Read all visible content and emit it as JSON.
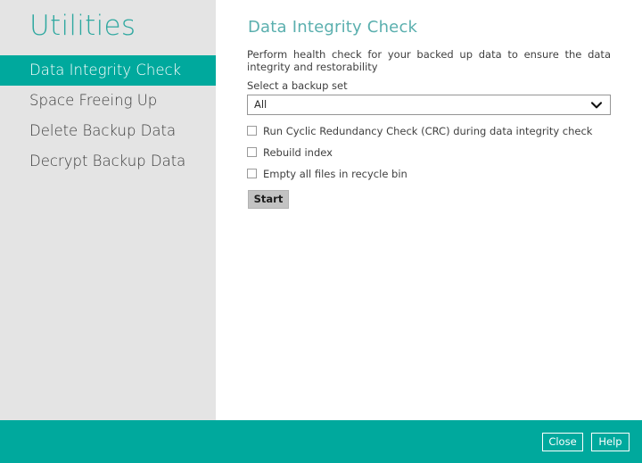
{
  "sidebar": {
    "title": "Utilities",
    "items": [
      {
        "label": "Data Integrity Check",
        "active": true
      },
      {
        "label": "Space Freeing Up",
        "active": false
      },
      {
        "label": "Delete Backup Data",
        "active": false
      },
      {
        "label": "Decrypt Backup Data",
        "active": false
      }
    ]
  },
  "panel": {
    "title": "Data Integrity Check",
    "description": "Perform health check for your backed up data to ensure the data integrity and restorability",
    "backup_set": {
      "label": "Select a backup set",
      "selected": "All",
      "dropdown_icon": "chevron-down-icon"
    },
    "checkboxes": [
      {
        "label": "Run Cyclic Redundancy Check (CRC) during data integrity check",
        "checked": false
      },
      {
        "label": "Rebuild index",
        "checked": false
      },
      {
        "label": "Empty all files in recycle bin",
        "checked": false
      }
    ],
    "start_label": "Start"
  },
  "footer": {
    "close_label": "Close",
    "help_label": "Help"
  },
  "colors": {
    "teal": "#00a99d",
    "title_teal": "#2fa8a0",
    "heading_teal": "#5aafae",
    "sidebar_bg": "#e4e4e4",
    "button_gray": "#c3c3c3"
  }
}
